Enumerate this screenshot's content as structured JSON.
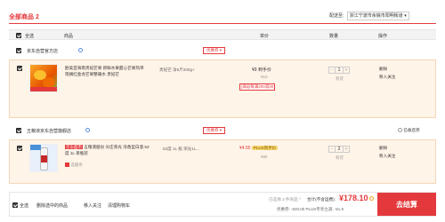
{
  "header": {
    "all_goods_label": "全部商品",
    "all_goods_count": "2",
    "ship_to_label": "配送至:",
    "ship_to_value": "浙江宁波市余姚市阳明街道"
  },
  "columns": {
    "select_all": "全选",
    "goods": "商品",
    "unit_price": "单价",
    "quantity": "数量",
    "action": "操作"
  },
  "store1": {
    "name": "京东自营官方店",
    "coupon_btn": "优惠券",
    "item": {
      "title": "欧美亚海南贵妃芒果 新鲜水果甜心芒果热带现摘红金龙芒果整箱水 贵妃芒",
      "spec": "贵妃芒 净5斤200g+",
      "price": "¥9 到手价",
      "original_price": "¥10",
      "promo": "[满返每满200减30",
      "qty": "1",
      "qty_note": "有货",
      "action_delete": "删除",
      "action_follow": "移入关注"
    }
  },
  "store2": {
    "name": "五粮液京东自营旗舰店",
    "coupon_btn": "优惠券",
    "collected": "已收店券",
    "item": {
      "badge": "京东超市",
      "title": "五粮液股份 尖庄荣光 浓香型白酒 52度 1L 单瓶装",
      "sub_badge": "选服务",
      "spec": "52度 1L 瓶 荣光1L...",
      "price": "¥4.55",
      "plus_tag": "PLUS到手价",
      "original_price": "¥95",
      "qty": "2",
      "qty_note": "有货",
      "action_delete": "删除",
      "action_follow": "移入关注"
    }
  },
  "footer": {
    "select_all": "全选",
    "delete_selected": "删除选中的商品",
    "move_to_follow": "移入关注",
    "clear_cart": "清理购物车",
    "selected_text": "已选择 3 件商品 ^",
    "total_label": "合计(不含运费):",
    "total_value": "¥178.10",
    "discount_text": "优惠券: -¥20.00 PLUS专享立减: -¥1.9",
    "checkout": "去结算"
  },
  "colors": {
    "accent": "#e4393c"
  }
}
